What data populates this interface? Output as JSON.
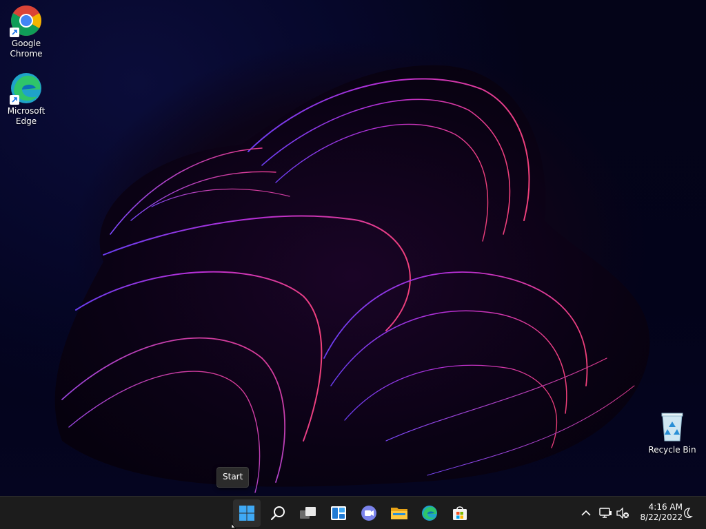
{
  "desktop": {
    "icons": [
      {
        "label": "Google\nChrome",
        "icon": "chrome-icon"
      },
      {
        "label": "Microsoft\nEdge",
        "icon": "edge-icon"
      },
      {
        "label": "Recycle Bin",
        "icon": "recycle-bin-icon"
      }
    ]
  },
  "tooltip": {
    "text": "Start"
  },
  "taskbar": {
    "apps": [
      {
        "name": "Start",
        "icon": "windows-start-icon",
        "active": true
      },
      {
        "name": "Search",
        "icon": "search-icon"
      },
      {
        "name": "Task View",
        "icon": "task-view-icon"
      },
      {
        "name": "Widgets",
        "icon": "widgets-icon"
      },
      {
        "name": "Chat",
        "icon": "teams-chat-icon"
      },
      {
        "name": "File Explorer",
        "icon": "file-explorer-icon"
      },
      {
        "name": "Microsoft Edge",
        "icon": "edge-icon"
      },
      {
        "name": "Microsoft Store",
        "icon": "store-icon"
      }
    ],
    "tray": {
      "icons": [
        "chevron-up-icon",
        "network-icon",
        "volume-muted-icon"
      ],
      "time": "4:16 AM",
      "date": "8/22/2022",
      "notification_icon": "notification-moon-icon"
    }
  },
  "colors": {
    "taskbar_bg": "#1c1c1c",
    "start_blue": "#3fa9f5",
    "wallpaper_accent": "#c2267a"
  }
}
